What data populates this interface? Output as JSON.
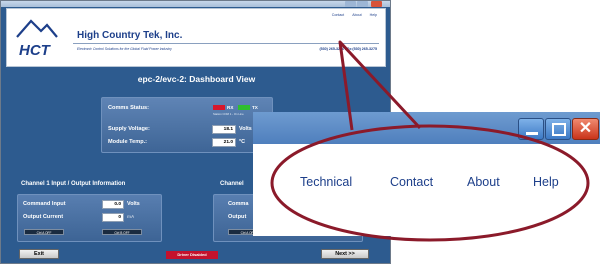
{
  "app": {
    "company": "High Country Tek, Inc.",
    "tagline": "Electronic Control Solutions for the Global Fluid Power Industry",
    "phone": "(530) 265-3236 / Fx:(530) 265-3275",
    "logo_text": "HCT",
    "nav_links": [
      "Contact",
      "About",
      "Help"
    ],
    "dashboard_title": "epc-2/evc-2: Dashboard View",
    "status": {
      "comms_label": "Comms Status:",
      "rx_label": "RX",
      "tx_label": "TX",
      "comms_sub": "Station COM 1 - On Line",
      "supply_label": "Supply Voltage:",
      "supply_value": "18.1",
      "supply_unit": "Volts",
      "temp_label": "Module Temp.:",
      "temp_value": "21.0",
      "temp_unit": "°C",
      "rx_color": "#d6172b",
      "tx_color": "#2fbf2f"
    },
    "channel1": {
      "title": "Channel 1 Input / Output Information",
      "command_label": "Command Input",
      "command_value": "0.0",
      "command_unit": "Volts",
      "output_label": "Output Current",
      "output_value": "0",
      "output_unit": "mA",
      "ctrl_a": "Ctrl A OFF",
      "ctrl_b": "Ctrl B OFF"
    },
    "channel2": {
      "title": "Channel",
      "command_label": "Comma",
      "output_label": "Output",
      "ctrl_a": "Ctrl A OFF",
      "ctrl_b": "Ctrl B OFF"
    },
    "exit_label": "Exit",
    "driver_label": "Driver Disabled",
    "next_label": "Next >>"
  },
  "zoom": {
    "links": [
      "Technical",
      "Contact",
      "About",
      "Help"
    ],
    "close_glyph": "✕",
    "accent": "#8b1a2a"
  }
}
